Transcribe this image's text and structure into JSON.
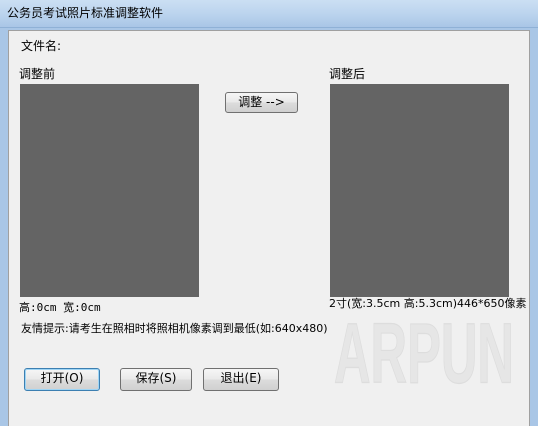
{
  "window": {
    "title": "公务员考试照片标准调整软件"
  },
  "form": {
    "filename_label": "文件名:",
    "before_label": "调整前",
    "after_label": "调整后",
    "adjust_button": "调整 -->",
    "before_size_text": "高:0cm  宽:0cm",
    "after_size_text": "2寸(宽:3.5cm 高:5.3cm)446*650像素",
    "tip_text": "友情提示:请考生在照相时将照相机像素调到最低(如:640x480)",
    "buttons": {
      "open": "打开(O)",
      "save": "保存(S)",
      "exit": "退出(E)"
    }
  },
  "watermark": {
    "text": "ARPUN"
  },
  "colors": {
    "image_placeholder": "#646464",
    "client_bg": "#f0f0f0",
    "titlebar": "#a9c6e6"
  }
}
